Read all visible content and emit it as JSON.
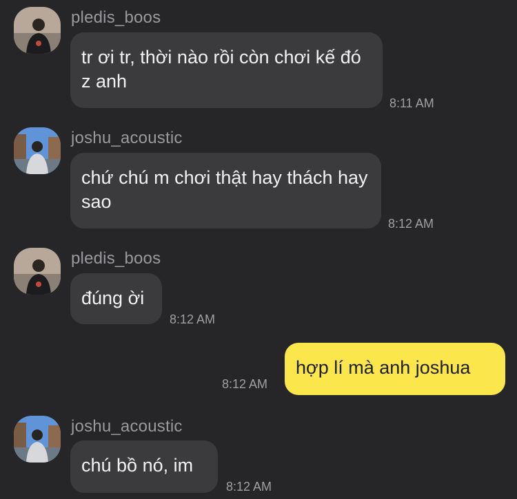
{
  "messages": [
    {
      "sender": "pledis_boos",
      "avatar": "avatar-pledis-boos",
      "text": "tr ơi tr, thời nào rồi còn chơi kế đó z anh",
      "time": "8:11 AM"
    },
    {
      "sender": "joshu_acoustic",
      "avatar": "avatar-joshu-acoustic",
      "text": "chứ chú m chơi thật hay thách hay sao",
      "time": "8:12 AM"
    },
    {
      "sender": "pledis_boos",
      "avatar": "avatar-pledis-boos",
      "text": "đúng ời",
      "time": "8:12 AM"
    },
    {
      "sender": "me",
      "text": "hợp lí mà anh joshua",
      "time": "8:12 AM"
    },
    {
      "sender": "joshu_acoustic",
      "avatar": "avatar-joshu-acoustic",
      "text": "chú bồ nó, im",
      "time": "8:12 AM"
    }
  ],
  "colors": {
    "background": "#262628",
    "incoming_bubble": "#3b3b3d",
    "outgoing_bubble": "#fbe74b"
  }
}
